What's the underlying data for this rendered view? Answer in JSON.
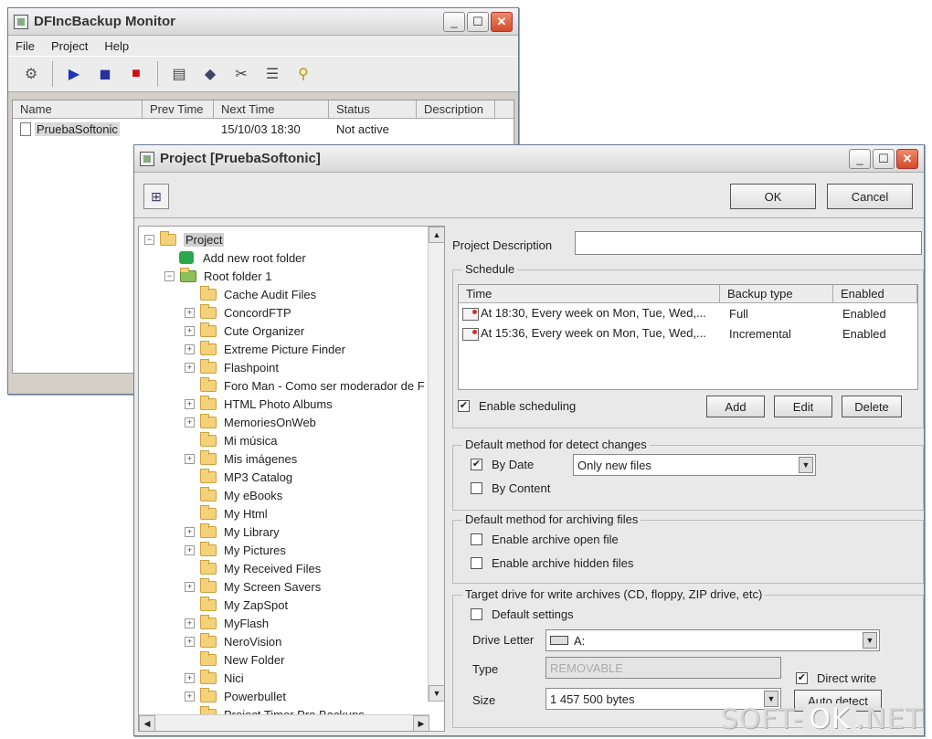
{
  "monitor": {
    "title": "DFIncBackup Monitor",
    "menu": [
      "File",
      "Project",
      "Help"
    ],
    "toolbar_icons": [
      "wizard-icon",
      "play-icon",
      "pause-icon",
      "stop-icon",
      "properties-icon",
      "archive-icon",
      "tools-icon",
      "log-icon",
      "tip-icon"
    ],
    "columns": [
      "Name",
      "Prev Time",
      "Next Time",
      "Status",
      "Description"
    ],
    "rows": [
      {
        "name": "PruebaSoftonic",
        "prev_time": "",
        "next_time": "15/10/03 18:30",
        "status": "Not active",
        "description": ""
      }
    ]
  },
  "project": {
    "title": "Project [PruebaSoftonic]",
    "ok_label": "OK",
    "cancel_label": "Cancel",
    "tree": {
      "root": "Project",
      "add_root": "Add new root folder",
      "root_folder": "Root folder 1",
      "folders": [
        {
          "label": "Cache Audit Files",
          "expandable": false
        },
        {
          "label": "ConcordFTP",
          "expandable": true
        },
        {
          "label": "Cute Organizer",
          "expandable": true
        },
        {
          "label": "Extreme Picture Finder",
          "expandable": true
        },
        {
          "label": "Flashpoint",
          "expandable": true
        },
        {
          "label": "Foro Man - Como ser moderador de F",
          "expandable": false
        },
        {
          "label": "HTML Photo Albums",
          "expandable": true
        },
        {
          "label": "MemoriesOnWeb",
          "expandable": true
        },
        {
          "label": "Mi música",
          "expandable": false
        },
        {
          "label": "Mis imágenes",
          "expandable": true
        },
        {
          "label": "MP3 Catalog",
          "expandable": false
        },
        {
          "label": "My eBooks",
          "expandable": false
        },
        {
          "label": "My Html",
          "expandable": false
        },
        {
          "label": "My Library",
          "expandable": true
        },
        {
          "label": "My Pictures",
          "expandable": true
        },
        {
          "label": "My Received Files",
          "expandable": false
        },
        {
          "label": "My Screen Savers",
          "expandable": true
        },
        {
          "label": "My ZapSpot",
          "expandable": false
        },
        {
          "label": "MyFlash",
          "expandable": true
        },
        {
          "label": "NeroVision",
          "expandable": true
        },
        {
          "label": "New Folder",
          "expandable": false
        },
        {
          "label": "Nici",
          "expandable": true
        },
        {
          "label": "Powerbullet",
          "expandable": true
        },
        {
          "label": "Project Timer Pro Backups",
          "expandable": false
        }
      ]
    },
    "description_label": "Project Description",
    "description_value": "",
    "schedule": {
      "group_title": "Schedule",
      "columns": [
        "Time",
        "Backup type",
        "Enabled"
      ],
      "rows": [
        {
          "time": "At 18:30, Every week on Mon, Tue, Wed,...",
          "type": "Full",
          "enabled": "Enabled"
        },
        {
          "time": "At 15:36, Every week on Mon, Tue, Wed,...",
          "type": "Incremental",
          "enabled": "Enabled"
        }
      ],
      "enable_label": "Enable scheduling",
      "enable_checked": true,
      "add_label": "Add",
      "edit_label": "Edit",
      "delete_label": "Delete"
    },
    "detect": {
      "group_title": "Default method for detect changes",
      "by_date_label": "By Date",
      "by_date_checked": true,
      "by_date_option": "Only new files",
      "by_content_label": "By Content",
      "by_content_checked": false
    },
    "archiving": {
      "group_title": "Default method for archiving files",
      "open_label": "Enable archive open file",
      "hidden_label": "Enable archive hidden files"
    },
    "target": {
      "group_title": "Target drive for write archives (CD, floppy, ZIP drive, etc)",
      "default_label": "Default settings",
      "drive_letter_label": "Drive Letter",
      "drive_letter_value": "A:",
      "type_label": "Type",
      "type_value": "REMOVABLE",
      "size_label": "Size",
      "size_value": "1 457 500 bytes",
      "direct_write_label": "Direct write",
      "direct_write_checked": true,
      "auto_detect_label": "Auto detect"
    }
  },
  "watermark": {
    "left": "SOFT-",
    "ok": "OK",
    "right": ".NET"
  }
}
